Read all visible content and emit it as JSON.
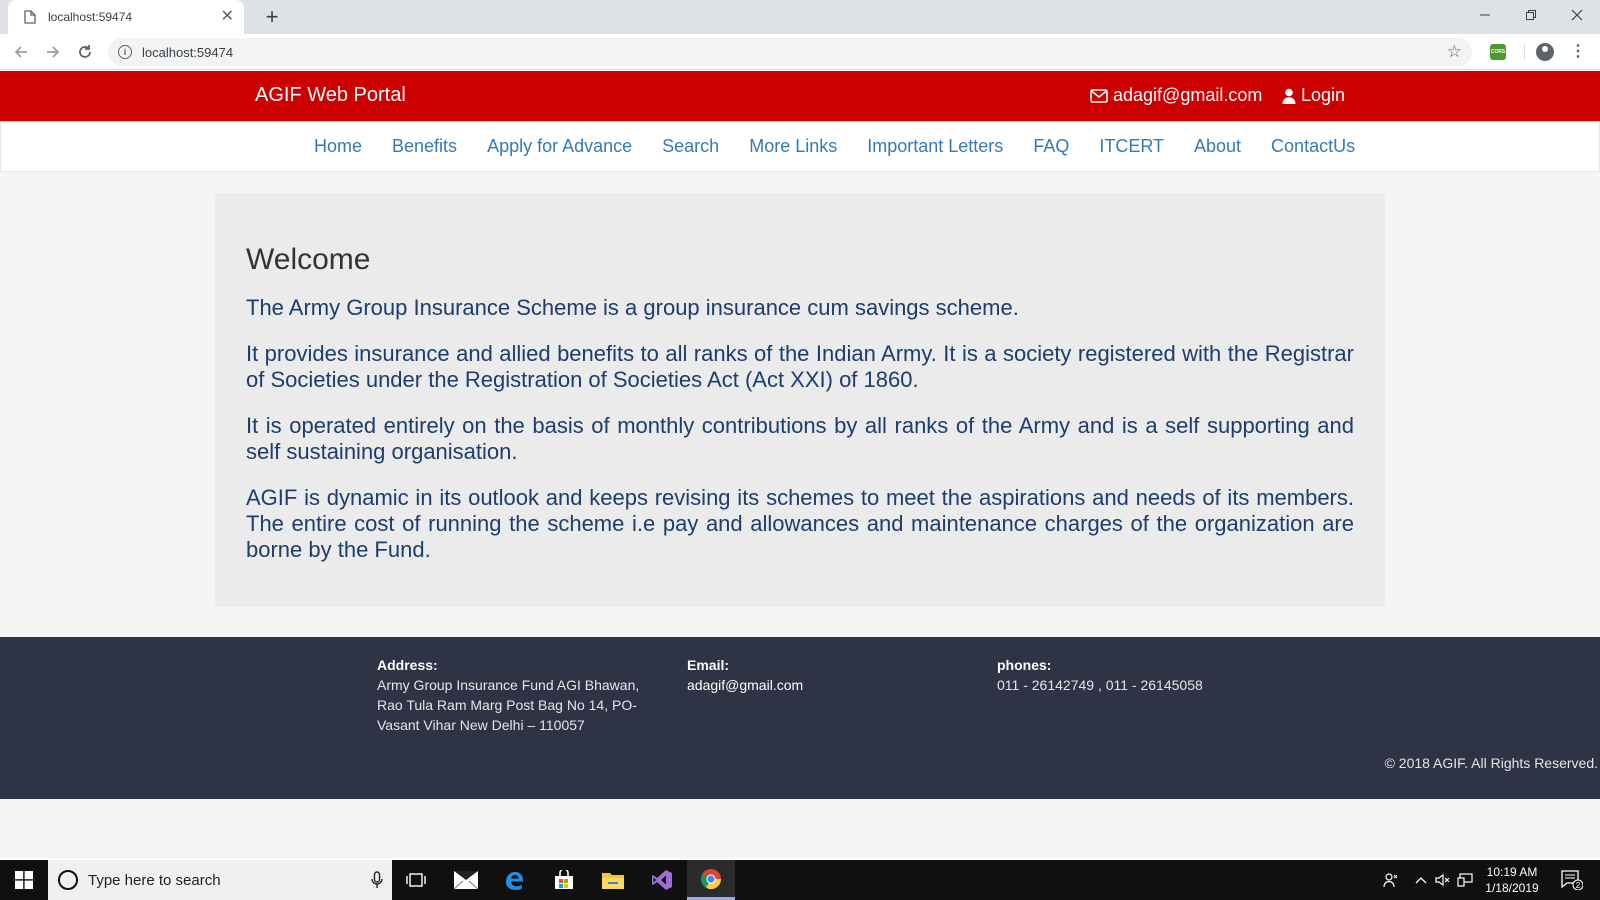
{
  "browser": {
    "tab_title": "localhost:59474",
    "new_tab": "+",
    "url": "localhost:59474",
    "ext_cors_label": "CORS"
  },
  "site": {
    "brand": "AGIF Web Portal",
    "email": "adagif@gmail.com",
    "login": "Login",
    "nav": [
      "Home",
      "Benefits",
      "Apply for Advance",
      "Search",
      "More Links",
      "Important Letters",
      "FAQ",
      "ITCERT",
      "About",
      "ContactUs"
    ],
    "welcome": "Welcome",
    "paragraphs": [
      "The Army Group Insurance Scheme is a group insurance cum savings scheme.",
      "It provides insurance and allied benefits to all ranks of the Indian Army. It is a society registered with the Registrar of Societies under the Registration of Societies Act (Act XXI) of 1860.",
      "It is operated entirely on the basis of monthly contributions by all ranks of the Army and is a self supporting and self sustaining organisation.",
      "AGIF is dynamic in its outlook and keeps revising its schemes to meet the aspirations and needs of its members. The entire cost of running the scheme i.e pay and allowances and maintenance charges of the organization are borne by the Fund."
    ]
  },
  "footer": {
    "address_label": "Address:",
    "address_text": "Army Group Insurance Fund AGI Bhawan, Rao Tula Ram Marg Post Bag No 14, PO-Vasant Vihar New Delhi – 110057",
    "email_label": "Email:",
    "email_text": "adagif@gmail.com",
    "phones_label": "phones:",
    "phones_text": "011 - 26142749 , 011 - 26145058",
    "copyright": "© 2018 AGIF. All Rights Reserved."
  },
  "taskbar": {
    "search_placeholder": "Type here to search",
    "time": "10:19 AM",
    "date": "1/18/2019",
    "notification_count": "2"
  },
  "colors": {
    "header_red": "#cc0000",
    "nav_link": "#337ab7",
    "body_text": "#1c3d6e",
    "footer_bg": "#2f3346"
  }
}
